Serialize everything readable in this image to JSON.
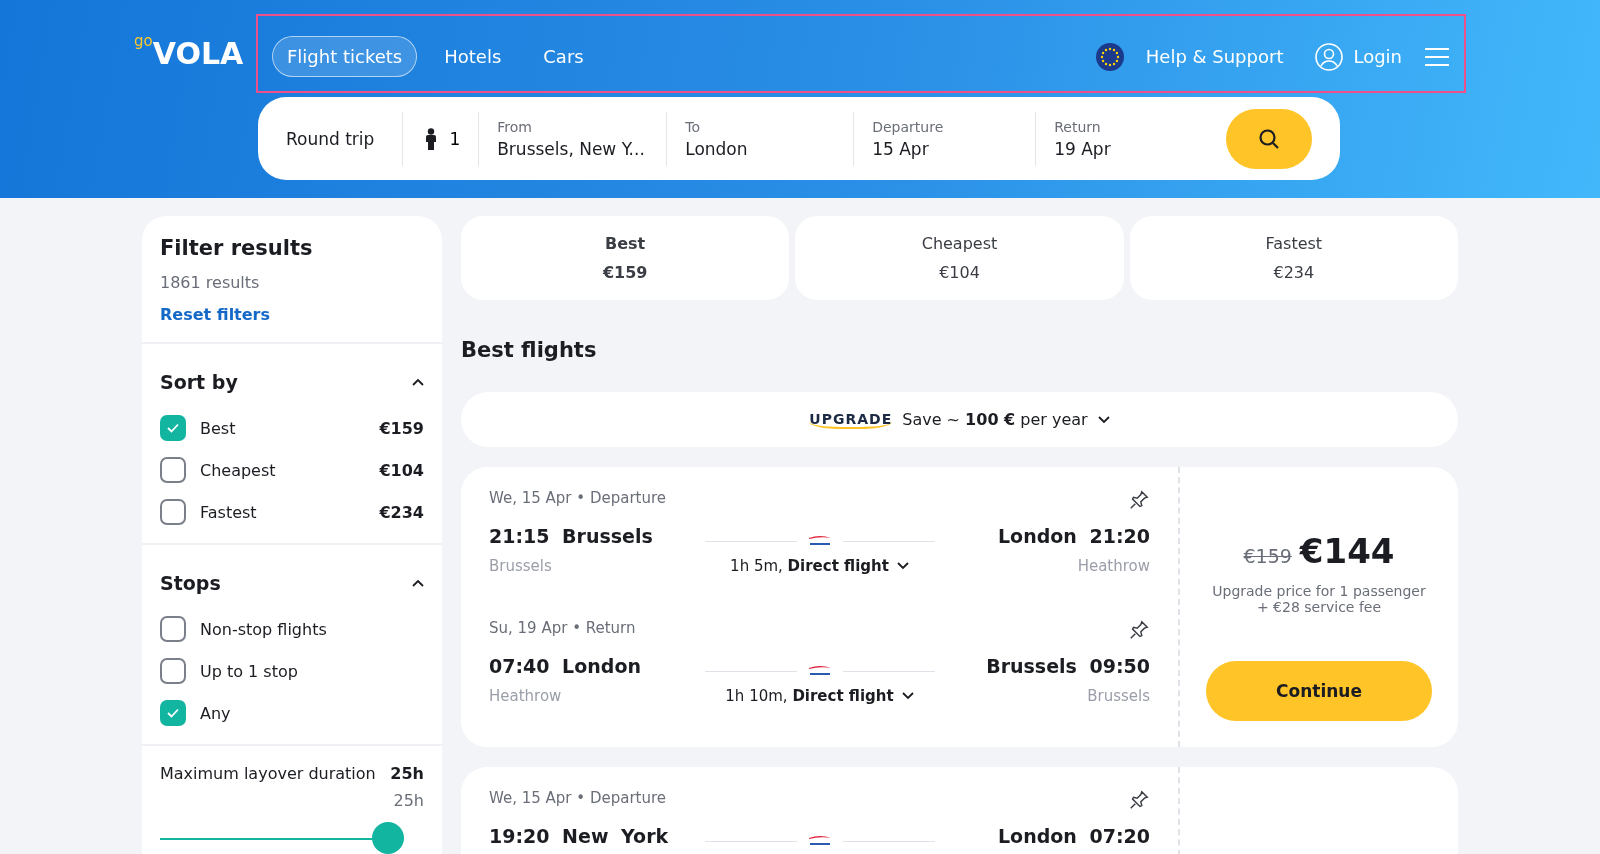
{
  "logo": {
    "prefix": "go",
    "name": "VOLA"
  },
  "nav": {
    "tabs": [
      {
        "label": "Flight tickets",
        "selected": true
      },
      {
        "label": "Hotels",
        "selected": false
      },
      {
        "label": "Cars",
        "selected": false
      }
    ],
    "help": "Help & Support",
    "login": "Login"
  },
  "search": {
    "trip_type": "Round trip",
    "passengers": "1",
    "fields": [
      {
        "label": "From",
        "value": "Brussels, New Y..."
      },
      {
        "label": "To",
        "value": "London"
      },
      {
        "label": "Departure",
        "value": "15 Apr"
      },
      {
        "label": "Return",
        "value": "19 Apr"
      }
    ]
  },
  "filter": {
    "title": "Filter results",
    "count": "1861 results",
    "reset": "Reset filters",
    "sections": [
      {
        "title": "Sort by",
        "expanded": true,
        "options": [
          {
            "label": "Best",
            "checked": true,
            "price": "€159"
          },
          {
            "label": "Cheapest",
            "checked": false,
            "price": "€104"
          },
          {
            "label": "Fastest",
            "checked": false,
            "price": "€234"
          }
        ]
      },
      {
        "title": "Stops",
        "expanded": true,
        "options": [
          {
            "label": "Non-stop flights",
            "checked": false
          },
          {
            "label": "Up to 1 stop",
            "checked": false
          },
          {
            "label": "Any",
            "checked": true
          }
        ]
      }
    ],
    "layover": {
      "label": "Maximum layover duration",
      "value": "25h",
      "reading": "25h",
      "level": 1
    }
  },
  "sort_tabs": [
    {
      "label": "Best",
      "price": "€159",
      "selected": true
    },
    {
      "label": "Cheapest",
      "price": "€104",
      "selected": false
    },
    {
      "label": "Fastest",
      "price": "€234",
      "selected": false
    }
  ],
  "section_title": "Best flights",
  "upgrade": {
    "brand": "UPGRADE",
    "text": "Save ~ **100 €** per year"
  },
  "flights": [
    {
      "legs": [
        {
          "header": "We, 15 Apr • Departure",
          "dep_time": "21:15",
          "dep_city": "Brussels",
          "dep_airport": "Brussels",
          "arr_city": "London",
          "arr_time": "21:20",
          "arr_airport": "Heathrow",
          "duration": "1h 5m, **Direct flight**"
        },
        {
          "header": "Su, 19 Apr • Return",
          "dep_time": "07:40",
          "dep_city": "London",
          "dep_airport": "Heathrow",
          "arr_city": "Brussels",
          "arr_time": "09:50",
          "arr_airport": "Brussels",
          "duration": "1h 10m, **Direct flight**"
        }
      ],
      "old_price": "€159",
      "price": "€144",
      "note": "Upgrade price for 1 passenger + €28 service fee",
      "button": "Continue"
    },
    {
      "legs": [
        {
          "header": "We, 15 Apr • Departure",
          "dep_time": "19:20",
          "dep_city": "New York",
          "arr_city": "London",
          "arr_time": "07:20"
        }
      ]
    }
  ]
}
